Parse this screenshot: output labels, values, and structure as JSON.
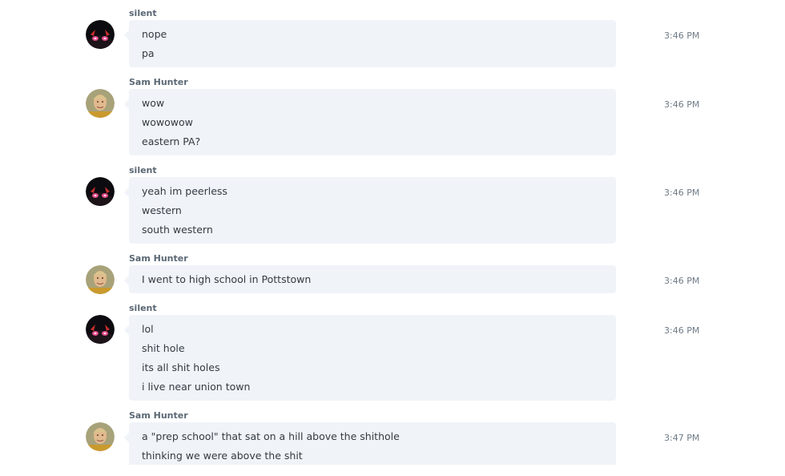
{
  "messages": [
    {
      "author": "silent",
      "avatar": "anime-avatar",
      "time": "3:46 PM",
      "lines": [
        "nope",
        "pa"
      ]
    },
    {
      "author": "Sam Hunter",
      "avatar": "person-avatar",
      "time": "3:46 PM",
      "lines": [
        "wow",
        "wowowow",
        "eastern PA?"
      ]
    },
    {
      "author": "silent",
      "avatar": "anime-avatar",
      "time": "3:46 PM",
      "lines": [
        "yeah im peerless",
        "western",
        "south western"
      ]
    },
    {
      "author": "Sam Hunter",
      "avatar": "person-avatar",
      "time": "3:46 PM",
      "lines": [
        "I went to high school in Pottstown"
      ]
    },
    {
      "author": "silent",
      "avatar": "anime-avatar",
      "time": "3:46 PM",
      "lines": [
        "lol",
        "shit hole",
        "its all shit holes",
        "i live near union town"
      ]
    },
    {
      "author": "Sam Hunter",
      "avatar": "person-avatar",
      "time": "3:47 PM",
      "lines": [
        "a \"prep school\" that sat on a hill above the shithole",
        "thinking we were above the shit"
      ]
    }
  ],
  "colors": {
    "bubble": "#f0f3f8",
    "author": "#5a6773",
    "text": "#333b42",
    "time": "#6f7b86"
  }
}
